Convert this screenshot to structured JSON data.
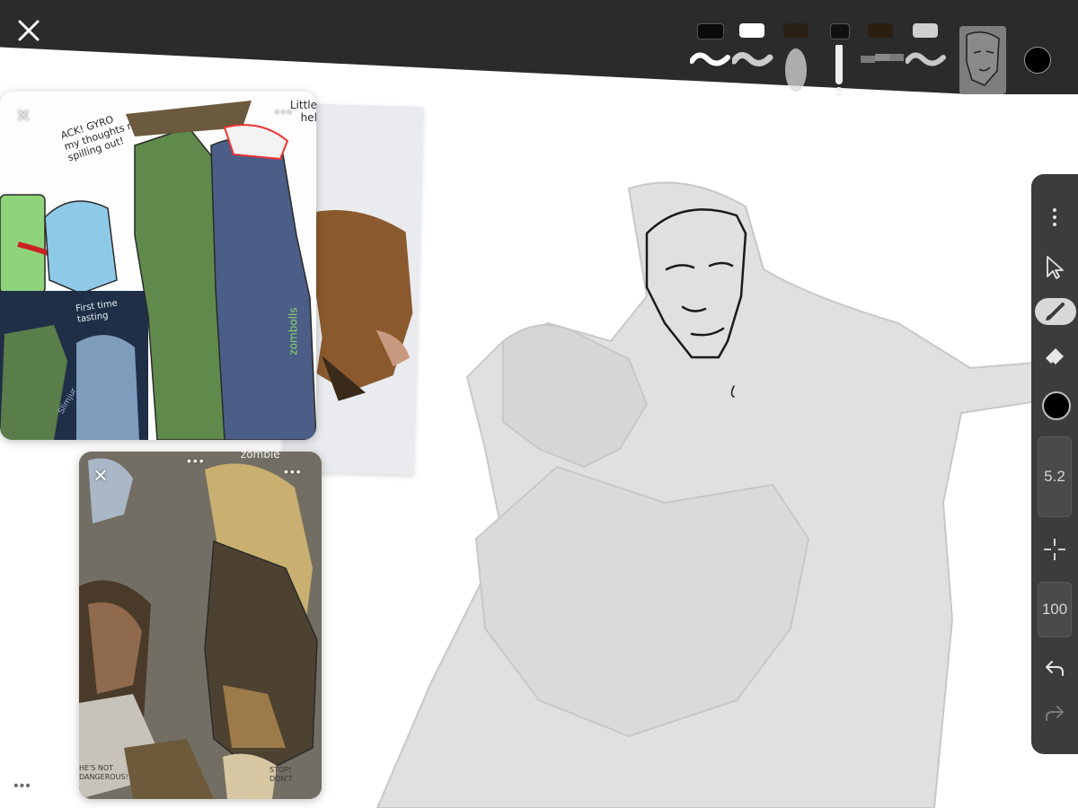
{
  "topbar": {
    "close_icon": "close-icon",
    "brushes": [
      {
        "name": "ink-brush",
        "swatch": "#0a0a0a"
      },
      {
        "name": "white-brush",
        "swatch": "#ffffff"
      },
      {
        "name": "airbrush",
        "swatch": "#2a1f14"
      },
      {
        "name": "pencil-brush",
        "swatch": "#101010",
        "active": true
      },
      {
        "name": "textured-brush",
        "swatch": "#2b1e10"
      },
      {
        "name": "gray-brush",
        "swatch": "#d0d0d0"
      }
    ],
    "reference_thumbnail": "face-sketch-thumbnail",
    "current_color": "#000000"
  },
  "reference_cards": {
    "card1": {
      "speech_bubble": "ACK! GYRO my thoughts r spilling out!",
      "caption": "First time tasting",
      "corner_text": "Little hel",
      "watermark": "zombolls",
      "signature": "Slimjur"
    },
    "card2": {
      "bottom_left_text": "HE'S NOT DANGEROUS!",
      "bottom_right_text": "STOP! DON'T",
      "top_text": "zombie"
    },
    "photo": "reference-photo-figure"
  },
  "bottom": {
    "more_label": "•••"
  },
  "toolpanel": {
    "more_icon": "more-vertical-icon",
    "tools": [
      "select-tool",
      "brush-tool",
      "eraser-tool"
    ],
    "active_tool": "brush-tool",
    "color": "#000000",
    "brush_size": "5.2",
    "opacity": "100",
    "undo_icon": "undo-icon",
    "redo_icon": "redo-icon"
  }
}
